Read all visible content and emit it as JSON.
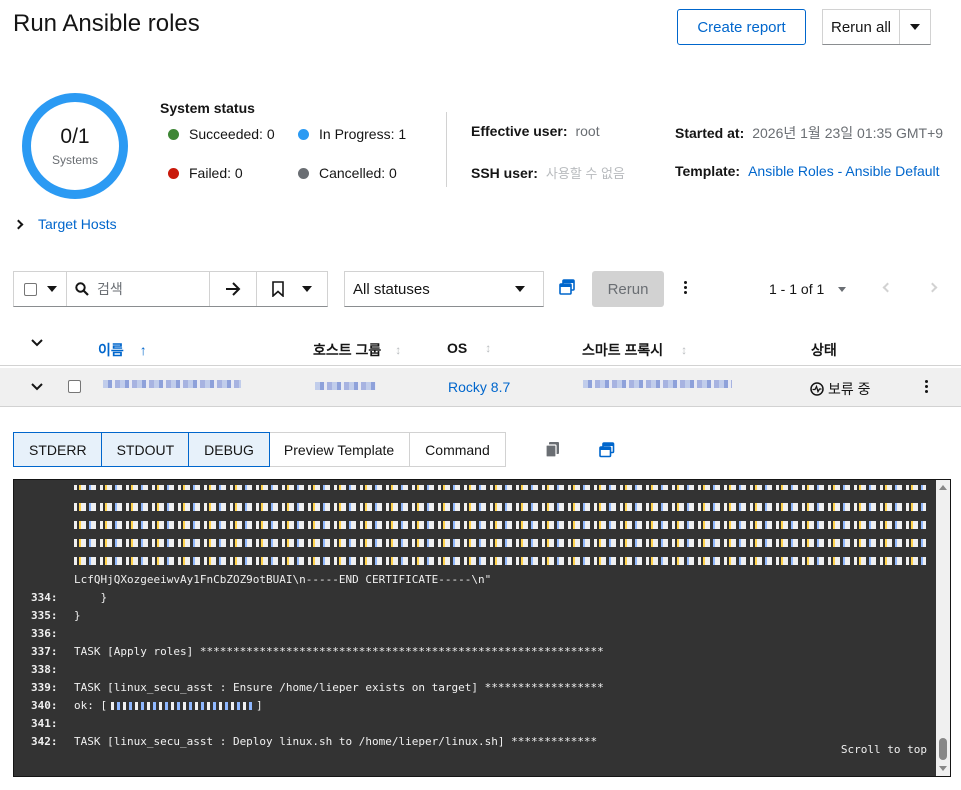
{
  "header": {
    "title": "Run Ansible roles",
    "create_report": "Create report",
    "rerun_all": "Rerun all"
  },
  "summary": {
    "donut_value": "0/1",
    "donut_label": "Systems",
    "system_status_title": "System status",
    "succeeded": "Succeeded: 0",
    "in_progress": "In Progress: 1",
    "failed": "Failed: 0",
    "cancelled": "Cancelled: 0",
    "effective_user_label": "Effective user:",
    "effective_user_value": "root",
    "ssh_user_label": "SSH user:",
    "ssh_user_value": "사용할 수 없음",
    "started_at_label": "Started at:",
    "started_at_value": "2026년 1월 23일 01:35 GMT+9",
    "template_label": "Template:",
    "template_value": "Ansible Roles - Ansible Default",
    "target_hosts": "Target Hosts",
    "colors": {
      "succeeded": "#3e8635",
      "in_progress": "#2b9af3",
      "failed": "#c9190b",
      "cancelled": "#6a6e73"
    }
  },
  "toolbar": {
    "search_placeholder": "검색",
    "status_select": "All statuses",
    "rerun": "Rerun",
    "pagination": "1 - 1 of 1"
  },
  "table": {
    "headers": {
      "name": "이름",
      "host_group": "호스트 그룹",
      "os": "OS",
      "smart_proxy": "스마트 프록시",
      "status": "상태"
    },
    "rows": [
      {
        "os": "Rocky 8.7",
        "status": "보류 중"
      }
    ]
  },
  "output": {
    "tabs": [
      "STDERR",
      "STDOUT",
      "DEBUG",
      "Preview Template",
      "Command"
    ],
    "lines": [
      {
        "n": "",
        "text": "LcfQHjQXozgeeiwvAy1FnCbZOZ9otBUAI\\n-----END CERTIFICATE-----\\n\""
      },
      {
        "n": "334:",
        "text": "    }"
      },
      {
        "n": "335:",
        "text": "}"
      },
      {
        "n": "336:",
        "text": ""
      },
      {
        "n": "337:",
        "text": "TASK [Apply roles] *************************************************************"
      },
      {
        "n": "338:",
        "text": ""
      },
      {
        "n": "339:",
        "text": "TASK [linux_secu_asst : Ensure /home/lieper exists on target] ******************"
      },
      {
        "n": "340:",
        "text": "ok: ["
      },
      {
        "n": "341:",
        "text": ""
      },
      {
        "n": "342:",
        "text": "TASK [linux_secu_asst : Deploy linux.sh to /home/lieper/linux.sh] *************"
      }
    ],
    "scroll_to_top": "Scroll to top"
  }
}
